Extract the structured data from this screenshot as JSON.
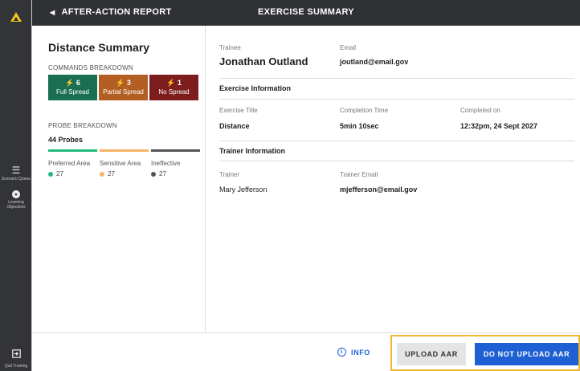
{
  "header": {
    "back_label": "AFTER-ACTION REPORT",
    "title": "EXERCISE SUMMARY"
  },
  "rail": {
    "items": [
      {
        "label": "Scenario Queue",
        "icon": "list-icon"
      },
      {
        "label": "Learning Objectives",
        "icon": "star-circle-icon"
      },
      {
        "label": "Quit Training",
        "icon": "exit-icon"
      }
    ]
  },
  "summary": {
    "title": "Distance Summary",
    "commands_label": "COMMANDS BREAKDOWN",
    "commands": [
      {
        "count": "6",
        "label": "Full Spread",
        "color": "#1a6f52"
      },
      {
        "count": "3",
        "label": "Partial Spread",
        "color": "#b35f23"
      },
      {
        "count": "1",
        "label": "No Spread",
        "color": "#7d1d1d"
      }
    ],
    "probe_label": "PROBE BREAKDOWN",
    "probe_count": "44 Probes",
    "probes": [
      {
        "label": "Preferred Area",
        "value": "27",
        "color": "#23b97f"
      },
      {
        "label": "Sensitive Area",
        "value": "27",
        "color": "#f7b466"
      },
      {
        "label": "Ineffective",
        "value": "27",
        "color": "#555555"
      }
    ]
  },
  "details": {
    "trainee_label": "Trainee",
    "trainee_name": "Jonathan Outland",
    "email_label": "Email",
    "email": "joutland@email.gov",
    "exercise_section": "Exercise Information",
    "exercise_title_label": "Exercise Title",
    "exercise_title": "Distance",
    "completion_time_label": "Completion Time",
    "completion_time": "5min 10sec",
    "completed_on_label": "Completed on",
    "completed_on": "12:32pm, 24 Sept 2027",
    "trainer_section": "Trainer Information",
    "trainer_label": "Trainer",
    "trainer": "Mary Jefferson",
    "trainer_email_label": "Trainer Email",
    "trainer_email": "mjefferson@email.gov"
  },
  "footer": {
    "info_label": "INFO",
    "upload_label": "UPLOAD AAR",
    "no_upload_label": "DO NOT UPLOAD AAR"
  },
  "colors": {
    "highlight": "#f0b632",
    "accent": "#1e60d3",
    "rail_bg": "#333438"
  }
}
